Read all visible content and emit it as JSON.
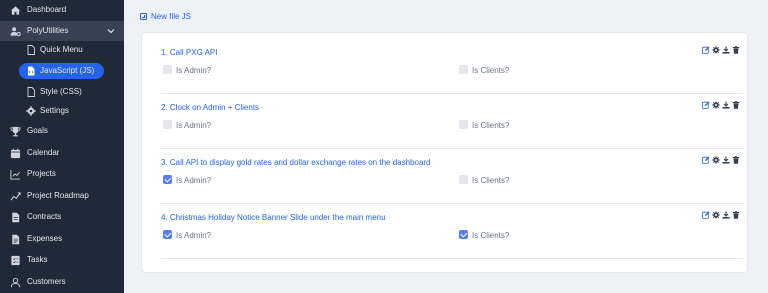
{
  "sidebar": {
    "items": [
      {
        "label": "Dashboard",
        "icon": "home-icon"
      },
      {
        "label": "PolyUtilities",
        "icon": "user-gear-icon"
      },
      {
        "label": "Goals",
        "icon": "trophy-icon"
      },
      {
        "label": "Calendar",
        "icon": "calendar-icon"
      },
      {
        "label": "Projects",
        "icon": "chart-line-icon"
      },
      {
        "label": "Project Roadmap",
        "icon": "roadmap-icon"
      },
      {
        "label": "Contracts",
        "icon": "contract-icon"
      },
      {
        "label": "Expenses",
        "icon": "expense-icon"
      },
      {
        "label": "Tasks",
        "icon": "tasks-icon"
      },
      {
        "label": "Customers",
        "icon": "users-icon"
      }
    ],
    "sub_items": [
      {
        "label": "Quick Menu",
        "icon": "file-icon"
      },
      {
        "label": "JavaScript (JS)",
        "icon": "file-code-icon"
      },
      {
        "label": "Style (CSS)",
        "icon": "file-icon"
      },
      {
        "label": "Settings",
        "icon": "gear-icon"
      }
    ]
  },
  "toolbar": {
    "new_file_label": "New file JS"
  },
  "entries": [
    {
      "title": "1. Call PXG API",
      "is_admin_label": "Is Admin?",
      "is_admin": false,
      "is_clients_label": "Is Clients?",
      "is_clients": false
    },
    {
      "title": "2. Clock on Admin + Clients",
      "is_admin_label": "Is Admin?",
      "is_admin": false,
      "is_clients_label": "Is Clients?",
      "is_clients": false
    },
    {
      "title": "3. Call API to display gold rates and dollar exchange rates on the dashboard",
      "is_admin_label": "Is Admin?",
      "is_admin": true,
      "is_clients_label": "Is Clients?",
      "is_clients": false
    },
    {
      "title": "4. Christmas Holiday Notice Banner Slide under the main menu",
      "is_admin_label": "Is Admin?",
      "is_admin": true,
      "is_clients_label": "Is Clients?",
      "is_clients": true
    }
  ],
  "colors": {
    "sidebar_bg": "#1f2937",
    "accent": "#2563eb",
    "checkbox_checked": "#5b7fe6"
  }
}
